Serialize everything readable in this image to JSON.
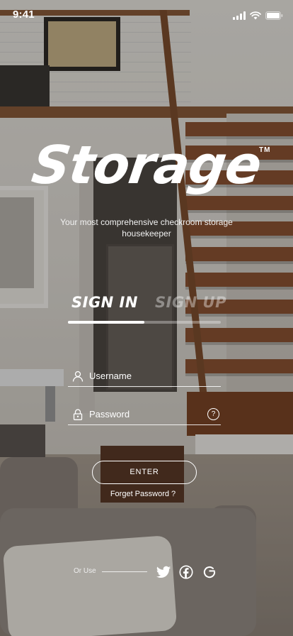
{
  "status_bar": {
    "time": "9:41",
    "icons": [
      "cellular-signal-icon",
      "wifi-icon",
      "battery-icon"
    ]
  },
  "brand": {
    "name": "Storage",
    "trademark": "TM",
    "tagline": "Your most comprehensive checkroom storage housekeeper"
  },
  "tabs": [
    {
      "label": "SIGN IN",
      "active": true
    },
    {
      "label": "SIGN UP",
      "active": false
    }
  ],
  "form": {
    "username": {
      "placeholder": "Username",
      "icon": "user-icon"
    },
    "password": {
      "placeholder": "Password",
      "icon": "lock-icon",
      "help_icon": "question-bubble-icon",
      "help_glyph": "?"
    },
    "enter_label": "ENTER",
    "forgot_label": "Forget Password ?"
  },
  "social": {
    "label": "Or Use",
    "providers": [
      "twitter-icon",
      "facebook-icon",
      "google-icon"
    ]
  },
  "colors": {
    "text": "#ffffff",
    "inactive_tab": "rgba(255,255,255,0.38)",
    "overlay": "rgba(0,0,0,0.28)"
  }
}
